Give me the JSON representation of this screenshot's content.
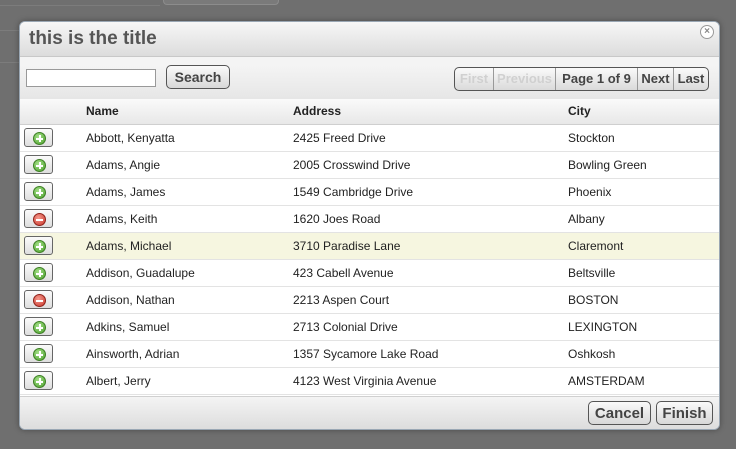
{
  "dialog": {
    "title": "this is the title",
    "close_icon": "close-icon"
  },
  "toolbar": {
    "search_value": "",
    "search_label": "Search"
  },
  "pager": {
    "first": "First",
    "previous": "Previous",
    "info": "Page 1 of 9",
    "next": "Next",
    "last": "Last"
  },
  "grid": {
    "columns": [
      "Name",
      "Address",
      "City"
    ],
    "rows": [
      {
        "action": "add",
        "name": "Abbott, Kenyatta",
        "address": "2425 Freed Drive",
        "city": "Stockton"
      },
      {
        "action": "add",
        "name": "Adams, Angie",
        "address": "2005 Crosswind Drive",
        "city": "Bowling Green"
      },
      {
        "action": "add",
        "name": "Adams, James",
        "address": "1549 Cambridge Drive",
        "city": "Phoenix"
      },
      {
        "action": "remove",
        "name": "Adams, Keith",
        "address": "1620 Joes Road",
        "city": "Albany"
      },
      {
        "action": "add",
        "name": "Adams, Michael",
        "address": "3710 Paradise Lane",
        "city": "Claremont",
        "highlighted": true
      },
      {
        "action": "add",
        "name": "Addison, Guadalupe",
        "address": "423 Cabell Avenue",
        "city": "Beltsville"
      },
      {
        "action": "remove",
        "name": "Addison, Nathan",
        "address": "2213 Aspen Court",
        "city": "BOSTON"
      },
      {
        "action": "add",
        "name": "Adkins, Samuel",
        "address": "2713 Colonial Drive",
        "city": "LEXINGTON"
      },
      {
        "action": "add",
        "name": "Ainsworth, Adrian",
        "address": "1357 Sycamore Lake Road",
        "city": "Oshkosh"
      },
      {
        "action": "add",
        "name": "Albert, Jerry",
        "address": "4123 West Virginia Avenue",
        "city": "AMSTERDAM"
      }
    ]
  },
  "footer": {
    "cancel_label": "Cancel",
    "finish_label": "Finish"
  },
  "colors": {
    "add_icon": "#4a9e2a",
    "remove_icon": "#c9352a",
    "highlight_row": "#f6f6e0",
    "overlay": "#6f6f6f"
  }
}
